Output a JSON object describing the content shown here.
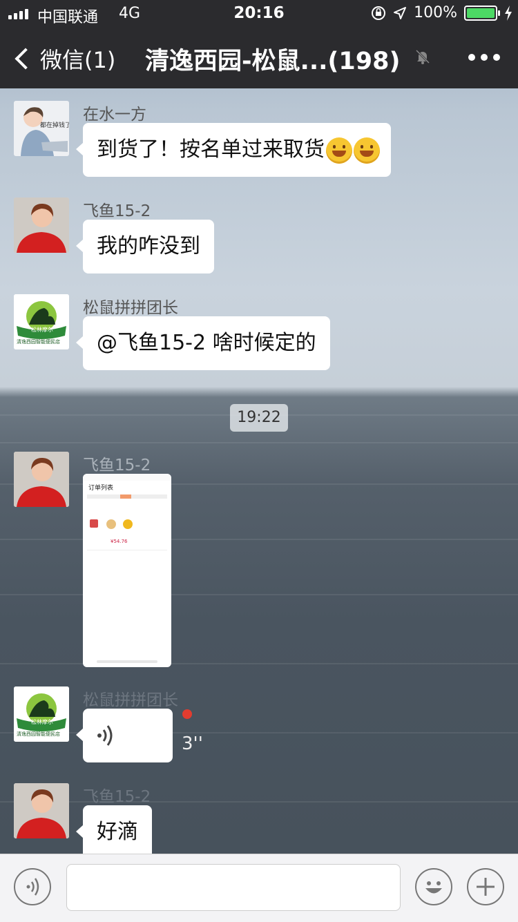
{
  "status_bar": {
    "carrier": "中国联通",
    "network": "4G",
    "time": "20:16",
    "battery": "100%"
  },
  "nav": {
    "back_label": "微信(1)",
    "title": "清逸西园-松鼠...(198)"
  },
  "messages": [
    {
      "sender": "在水一方",
      "text": "到货了！按名单过来取货",
      "avatar_text": "都在掉钱了"
    },
    {
      "sender": "飞鱼15-2",
      "text": "我的咋没到"
    },
    {
      "sender": "松鼠拼拼团长",
      "text": "@飞鱼15-2 啥时候定的",
      "avatar_title": "松林摩尔",
      "avatar_sub": "清逸西园智能便民店"
    },
    {
      "sender": "飞鱼15-2",
      "image_title": "订单列表",
      "image_amount": "¥54.76"
    },
    {
      "sender": "松鼠拼拼团长",
      "voice_duration": "3''",
      "avatar_title": "松林摩尔",
      "avatar_sub": "清逸西园智能便民店"
    },
    {
      "sender": "飞鱼15-2",
      "text": "好滴"
    }
  ],
  "timestamp": "19:22",
  "colors": {
    "nav_bg": "#2b2b2e",
    "bubble": "#ffffff",
    "battery": "#4cd964",
    "unread_dot": "#e23c2f"
  },
  "icons": [
    "signal-icon",
    "orientation-lock-icon",
    "location-icon",
    "battery-icon",
    "charging-icon",
    "mute-icon",
    "more-icon",
    "voice-icon",
    "emoji-icon",
    "plus-icon"
  ]
}
